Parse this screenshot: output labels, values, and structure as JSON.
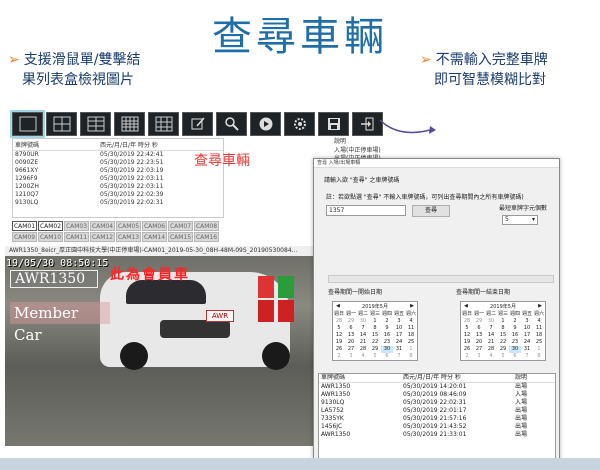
{
  "page_title": "查尋車輛",
  "bullet_left": [
    "支援滑鼠單/雙擊結",
    "果列表盒檢視圖片"
  ],
  "bullet_right": [
    "不需輸入完整車牌",
    "即可智慧模糊比對"
  ],
  "bullet_mark": "➢",
  "query_label": "查尋車輛",
  "toolbar_icons": [
    "grid-1-icon",
    "grid-4-icon",
    "grid-8-icon",
    "grid-16-icon",
    "grid-9-icon",
    "edit-icon",
    "search-icon",
    "play-icon",
    "settings-icon",
    "save-icon",
    "exit-icon"
  ],
  "list": {
    "headers": [
      "車牌號碼",
      "西元/月/日/年 時分 秒"
    ],
    "rows": [
      [
        "8790UR",
        "05/30/2019 22:42:41"
      ],
      [
        "0090ZE",
        "05/30/2019 22:23:51"
      ],
      [
        "9661XY",
        "05/30/2019 22:03:19"
      ],
      [
        "1296F9",
        "05/30/2019 22:03:11"
      ],
      [
        "1200ZH",
        "05/30/2019 22:03:11"
      ],
      [
        "1210Q7",
        "05/30/2019 22:02:39"
      ],
      [
        "9130LQ",
        "05/30/2019 22:02:31"
      ]
    ]
  },
  "right_info": {
    "header": "說明",
    "rows": [
      "入場(中正停車場)",
      "出場(中正停車場)"
    ]
  },
  "cams_row1": [
    "CAM01",
    "CAM02",
    "CAM03",
    "CAM04",
    "CAM05",
    "CAM06",
    "CAM07",
    "CAM08"
  ],
  "cams_row2": [
    "CAM09",
    "CAM10",
    "CAM11",
    "CAM12",
    "CAM13",
    "CAM14",
    "CAM15",
    "CAM16"
  ],
  "video": {
    "caption": "AWR1350_8eicr_厚正園中科技大學(中正停車場)-CAM01_2019-05-30_08H-48M-09S_20190530084...",
    "timestamp": "19/05/30  08:50:15",
    "plate_overlay": "AWR1350",
    "member_car": "Member Car",
    "member_label": "此為會員車",
    "plate_on_car": "AWR"
  },
  "dialog": {
    "title": "查尋 入場/出場車輛",
    "prompt": "請輸入欲 \"查尋\" 之車牌號碼",
    "hint": "註：若欲點選 \"查尋\" 不輸入車牌號碼，可列出查尋期間內之所有車牌號碼)",
    "input_value": "1357",
    "query_button": "查尋",
    "min_label": "最短車牌字元個數",
    "min_value": "5",
    "section_start": "查尋期間一開始日期",
    "section_end": "查尋期間一結束日期",
    "cal_month": "2019年5月",
    "weekdays": [
      "週日",
      "週一",
      "週二",
      "週三",
      "週四",
      "週五",
      "週六"
    ],
    "cal_days": [
      [
        "28",
        "29",
        "30",
        "1",
        "2",
        "3",
        "4"
      ],
      [
        "5",
        "6",
        "7",
        "8",
        "9",
        "10",
        "11"
      ],
      [
        "12",
        "13",
        "14",
        "15",
        "16",
        "17",
        "18"
      ],
      [
        "19",
        "20",
        "21",
        "22",
        "23",
        "24",
        "25"
      ],
      [
        "26",
        "27",
        "28",
        "29",
        "30",
        "31",
        "1"
      ],
      [
        "2",
        "3",
        "4",
        "5",
        "6",
        "7",
        "8"
      ]
    ],
    "results_headers": [
      "車牌號碼",
      "西元/月/日/年 時分 秒",
      "說明"
    ],
    "results": [
      [
        "AWR1350",
        "05/30/2019 14:20:01",
        "出場"
      ],
      [
        "AWR1350",
        "05/30/2019 08:46:09",
        "入場"
      ],
      [
        "9130LQ",
        "05/30/2019 22:02:31",
        "入場"
      ],
      [
        "LA5752",
        "05/30/2019 22:01:17",
        "出場"
      ],
      [
        "7335YK",
        "05/30/2019 21:57:16",
        "出場"
      ],
      [
        "1456JC",
        "05/30/2019 21:43:52",
        "出場"
      ],
      [
        "AWR1350",
        "05/30/2019 21:33:01",
        "出場"
      ]
    ]
  }
}
